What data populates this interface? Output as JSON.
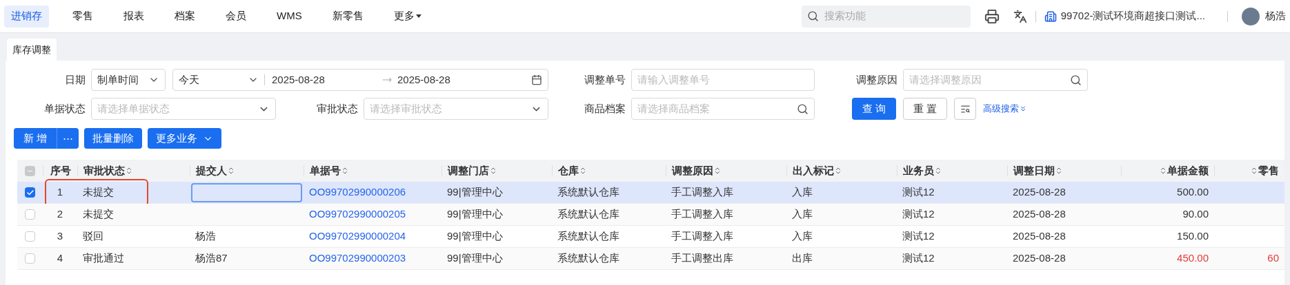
{
  "nav": {
    "items": [
      {
        "label": "进销存",
        "selected": true,
        "caret": false
      },
      {
        "label": "零售",
        "selected": false,
        "caret": false
      },
      {
        "label": "报表",
        "selected": false,
        "caret": false
      },
      {
        "label": "档案",
        "selected": false,
        "caret": false
      },
      {
        "label": "会员",
        "selected": false,
        "caret": false
      },
      {
        "label": "WMS",
        "selected": false,
        "caret": false
      },
      {
        "label": "新零售",
        "selected": false,
        "caret": false
      },
      {
        "label": "更多",
        "selected": false,
        "caret": true
      }
    ],
    "search": {
      "placeholder": "搜索功能"
    },
    "store": "99702-测试环境商超接口测试...",
    "user": "杨浩"
  },
  "page_tabs": [
    {
      "label": "库存调整",
      "selected": true
    }
  ],
  "filters": {
    "date": {
      "label": "日期",
      "type_value": "制单时间",
      "period_value": "今天",
      "start": "2025-08-28",
      "end": "2025-08-28"
    },
    "adjust_no": {
      "label": "调整单号",
      "placeholder": "请输入调整单号"
    },
    "reason": {
      "label": "调整原因",
      "placeholder": "请选择调整原因"
    },
    "doc_status": {
      "label": "单据状态",
      "placeholder": "请选择单据状态"
    },
    "approval_status": {
      "label": "审批状态",
      "placeholder": "请选择审批状态"
    },
    "product": {
      "label": "商品档案",
      "placeholder": "请选择商品档案"
    },
    "query": "查 询",
    "reset": "重 置",
    "advanced": "高级搜索"
  },
  "toolbar": {
    "add": "新 增",
    "more_dots": "⋯",
    "batch_delete": "批量删除",
    "more_business": "更多业务"
  },
  "table": {
    "header_checkbox": {
      "indeterminate": true
    },
    "columns": [
      {
        "label": "序号",
        "sortable": false
      },
      {
        "label": "审批状态",
        "sortable": true
      },
      {
        "label": "提交人",
        "sortable": true
      },
      {
        "label": "单据号",
        "sortable": true
      },
      {
        "label": "调整门店",
        "sortable": true
      },
      {
        "label": "仓库",
        "sortable": true
      },
      {
        "label": "调整原因",
        "sortable": true
      },
      {
        "label": "出入标记",
        "sortable": true
      },
      {
        "label": "业务员",
        "sortable": true
      },
      {
        "label": "调整日期",
        "sortable": true
      },
      {
        "label": "单据金额",
        "sortable": true
      },
      {
        "label": "零售",
        "sortable": true
      }
    ],
    "rows": [
      {
        "checked": true,
        "selected": true,
        "highlighted": true,
        "editing": true,
        "negative": false,
        "cells": [
          "1",
          "未提交",
          "",
          "OO99702990000206",
          "99|管理中心",
          "系统默认仓库",
          "手工调整入库",
          "入库",
          "测试12",
          "2025-08-28",
          "500.00",
          ""
        ]
      },
      {
        "checked": false,
        "selected": false,
        "highlighted": false,
        "editing": false,
        "negative": false,
        "cells": [
          "2",
          "未提交",
          "",
          "OO99702990000205",
          "99|管理中心",
          "系统默认仓库",
          "手工调整入库",
          "入库",
          "测试12",
          "2025-08-28",
          "90.00",
          ""
        ]
      },
      {
        "checked": false,
        "selected": false,
        "highlighted": false,
        "editing": false,
        "negative": false,
        "cells": [
          "3",
          "驳回",
          "杨浩",
          "OO99702990000204",
          "99|管理中心",
          "系统默认仓库",
          "手工调整入库",
          "入库",
          "测试12",
          "2025-08-28",
          "150.00",
          ""
        ]
      },
      {
        "checked": false,
        "selected": false,
        "highlighted": false,
        "editing": false,
        "negative": true,
        "cells": [
          "4",
          "审批通过",
          "杨浩87",
          "OO99702990000203",
          "99|管理中心",
          "系统默认仓库",
          "手工调整出库",
          "出库",
          "测试12",
          "2025-08-28",
          "450.00",
          "60"
        ]
      }
    ]
  }
}
